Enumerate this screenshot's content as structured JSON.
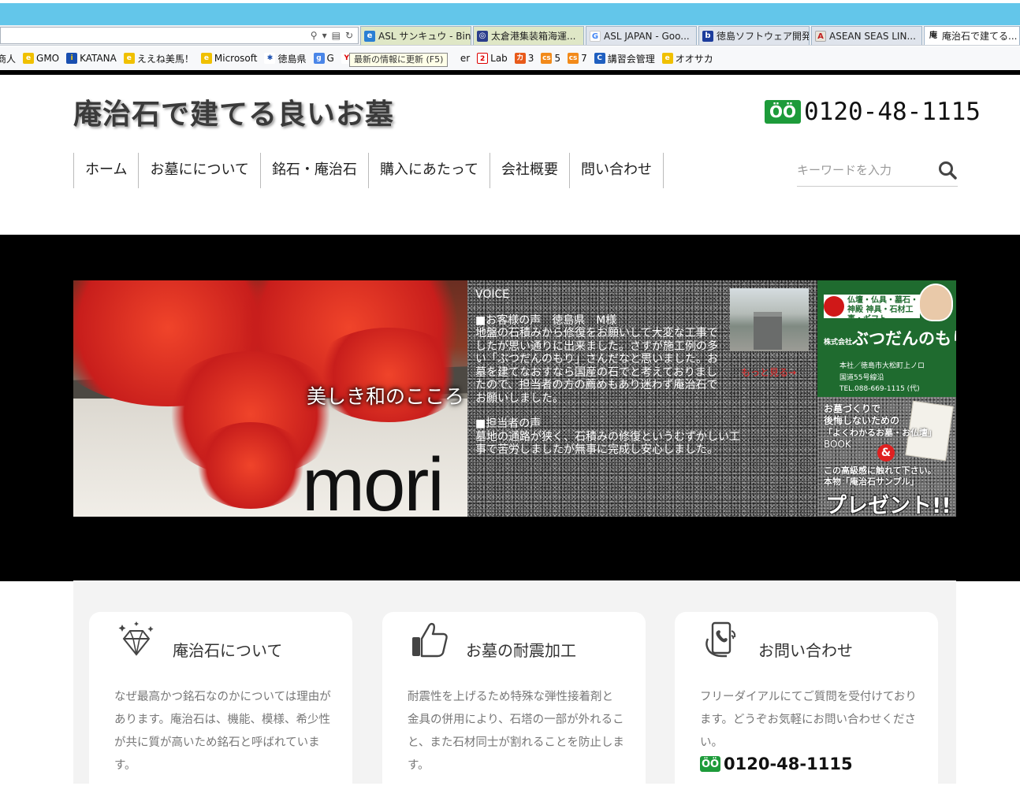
{
  "browser": {
    "tabs": [
      {
        "label": "ASL サンキュウ - Bing",
        "icon": "ie-icon",
        "state": "highlighted"
      },
      {
        "label": "太倉港集装箱海運...",
        "icon": "ship-logo-icon",
        "state": "highlighted"
      },
      {
        "label": "ASL JAPAN - Goo...",
        "icon": "google-icon",
        "state": "normal"
      },
      {
        "label": "徳島ソフトウェア開発...",
        "icon": "b-icon",
        "state": "normal"
      },
      {
        "label": "ASEAN SEAS LIN...",
        "icon": "asl-logo-icon",
        "state": "normal"
      },
      {
        "label": "庵治石で建てる...",
        "icon": "site-favicon",
        "state": "active"
      }
    ],
    "favorites": [
      {
        "label": "商人",
        "icon": "page-icon"
      },
      {
        "label": "GMO",
        "icon": "ie-icon"
      },
      {
        "label": "KATANA",
        "icon": "info-icon"
      },
      {
        "label": "ええね美馬！",
        "icon": "ie-icon"
      },
      {
        "label": "Microsoft",
        "icon": "ie-icon"
      },
      {
        "label": "徳島県",
        "icon": "tokushima-icon"
      },
      {
        "label": "G",
        "icon": "google-icon"
      },
      {
        "label": "Y",
        "icon": "yahoo-icon"
      },
      {
        "label": "er",
        "icon": ""
      },
      {
        "label": "Lab",
        "icon": "lab-icon"
      },
      {
        "label": "3",
        "icon": "ka-icon"
      },
      {
        "label": "5",
        "icon": "cs-icon"
      },
      {
        "label": "7",
        "icon": "cs-icon"
      },
      {
        "label": "講習会管理",
        "icon": "c-icon"
      },
      {
        "label": "オオサカ",
        "icon": "ie-icon"
      }
    ],
    "tooltip": "最新の情報に更新 (F5)"
  },
  "header": {
    "site_title": "庵治石で建てる良いお墓",
    "phone": "0120-48-1115",
    "phone_icon_label": "ÖÖ"
  },
  "nav": {
    "items": [
      "ホーム",
      "お墓にについて",
      "銘石・庵治石",
      "購入にあたって",
      "会社概要",
      "問い合わせ"
    ]
  },
  "search": {
    "placeholder": "キーワードを入力"
  },
  "hero": {
    "caption": "美しき和のこころ",
    "brand_word": "mori",
    "voice": {
      "title": "VOICE",
      "customer_heading": "■お客様の声　徳島県　M様",
      "customer_text": "地盤の石積みから修復をお願いして大変な工事でしたが思い通りに出来ました。さすが施工例の多い「ぶつだんのもり」さんだなと思いました。お墓を建てなおすなら国産の石でと考えておりましたので、担当者の方の薦めもあり迷わず庵治石でお願いしました。",
      "staff_heading": "■担当者の声",
      "staff_text": "墓地の通路が狭く、石積みの修復というむずかしい工事で苦労しましたが無事に完成し安心しました。",
      "more_link": "もっと見る→"
    },
    "ad_company": {
      "tagline": "仏壇・仏具・墓石・神殿 神具・石材工事・ギフト",
      "corp_prefix": "株式会社",
      "name": "ぶつだんのもり",
      "address1": "本社／徳島市大松町上ノロ",
      "address2": "国道55号線沿",
      "tel": "TEL.088-669-1115 (代)"
    },
    "ad_book": {
      "line1": "お墓づくりで",
      "line2": "後悔しないための",
      "line3": "「よくわかるお墓・お仏壇」",
      "line4": "BOOK",
      "amp": "&",
      "line5": "この高級感に触れて下さい。",
      "line6": "本物「庵治石サンプル」",
      "gift": "プレゼント!!"
    }
  },
  "features": [
    {
      "title": "庵治石について",
      "icon": "diamond-icon",
      "text": "なぜ最高かつ銘石なのかについては理由があります。庵治石は、機能、模様、希少性が共に質が高いため銘石と呼ばれています。"
    },
    {
      "title": "お墓の耐震加工",
      "icon": "thumbs-up-icon",
      "text": "耐震性を上げるため特殊な弾性接着剤と金具の併用により、石塔の一部が外れること、また石材同士が割れることを防止します。"
    },
    {
      "title": "お問い合わせ",
      "icon": "phone-hand-icon",
      "text": "フリーダイアルにてご質問を受付けております。どうぞお気軽にお問い合わせください。",
      "phone": "0120-48-1115"
    }
  ],
  "colors": {
    "accent_green": "#1d9b3a",
    "chrome_blue": "#63c6ea",
    "more_link_red": "#e02020"
  }
}
